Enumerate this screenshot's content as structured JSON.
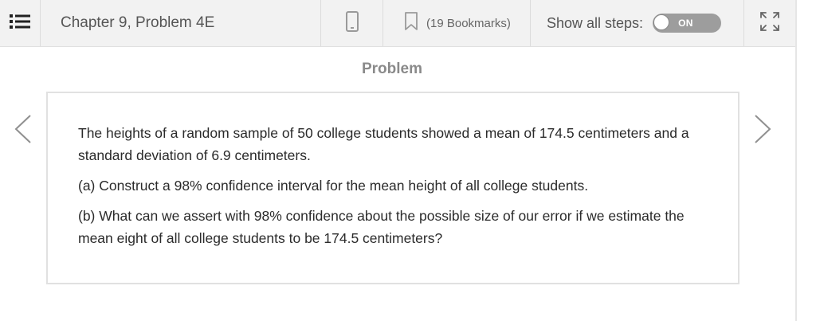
{
  "toolbar": {
    "title": "Chapter 9, Problem 4E",
    "bookmarks_label": "(19 Bookmarks)",
    "show_steps_label": "Show all steps:",
    "toggle_state": "ON",
    "icons": {
      "menu": "list-menu-icon",
      "device": "phone-icon",
      "bookmark": "bookmark-icon",
      "expand": "expand-icon"
    }
  },
  "section_heading": "Problem",
  "problem": {
    "paragraphs": [
      "The heights of a random sample of 50 college students showed a mean of 174.5 centimeters and a standard deviation of 6.9 centimeters.",
      "(a) Construct a 98% confidence interval for the mean height of all college students.",
      "(b) What can we assert with 98% confidence about the possible size of our error if we estimate the mean eight of all college students to be 174.5 centimeters?"
    ]
  },
  "navigation": {
    "prev_icon": "chevron-left-icon",
    "next_icon": "chevron-right-icon"
  },
  "colors": {
    "toolbar_bg": "#f2f2f2",
    "toggle_bg": "#9d9d9d",
    "heading": "#8a8a8a"
  }
}
